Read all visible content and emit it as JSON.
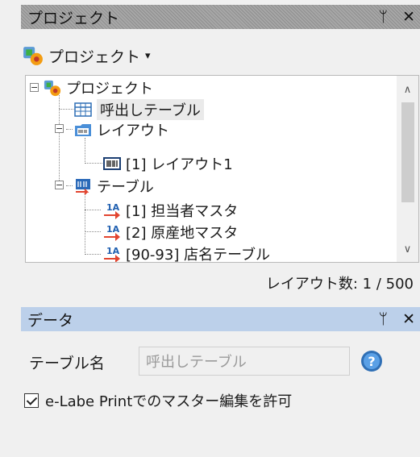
{
  "project_panel": {
    "title": "プロジェクト",
    "pin_glyph": "ᛘ",
    "close_glyph": "✕",
    "toolbar_label": "プロジェクト",
    "toolbar_caret": "▾"
  },
  "tree": {
    "root": "プロジェクト",
    "call_table": "呼出しテーブル",
    "layout_group": "レイアウト",
    "layout_item": "[1] レイアウト1",
    "table_group": "テーブル",
    "table_items": [
      "[1] 担当者マスタ",
      "[2] 原産地マスタ",
      "[90-93] 店名テーブル"
    ],
    "expander_minus": "−"
  },
  "layout_count": "レイアウト数: 1 / 500",
  "data_panel": {
    "title": "データ",
    "pin_glyph": "ᛘ",
    "close_glyph": "✕",
    "table_name_label": "テーブル名",
    "table_name_value": "呼出しテーブル",
    "allow_edit_label": "e-Labe Printでのマスター編集を許可",
    "allow_edit_checked": true
  },
  "icons": {
    "project": "project-gear-icon",
    "table": "grid-table-icon",
    "layout": "layout-folder-icon",
    "layout_item": "barcode-layout-icon",
    "table_group": "table-group-icon",
    "master": "master-table-icon",
    "help": "help-icon"
  }
}
